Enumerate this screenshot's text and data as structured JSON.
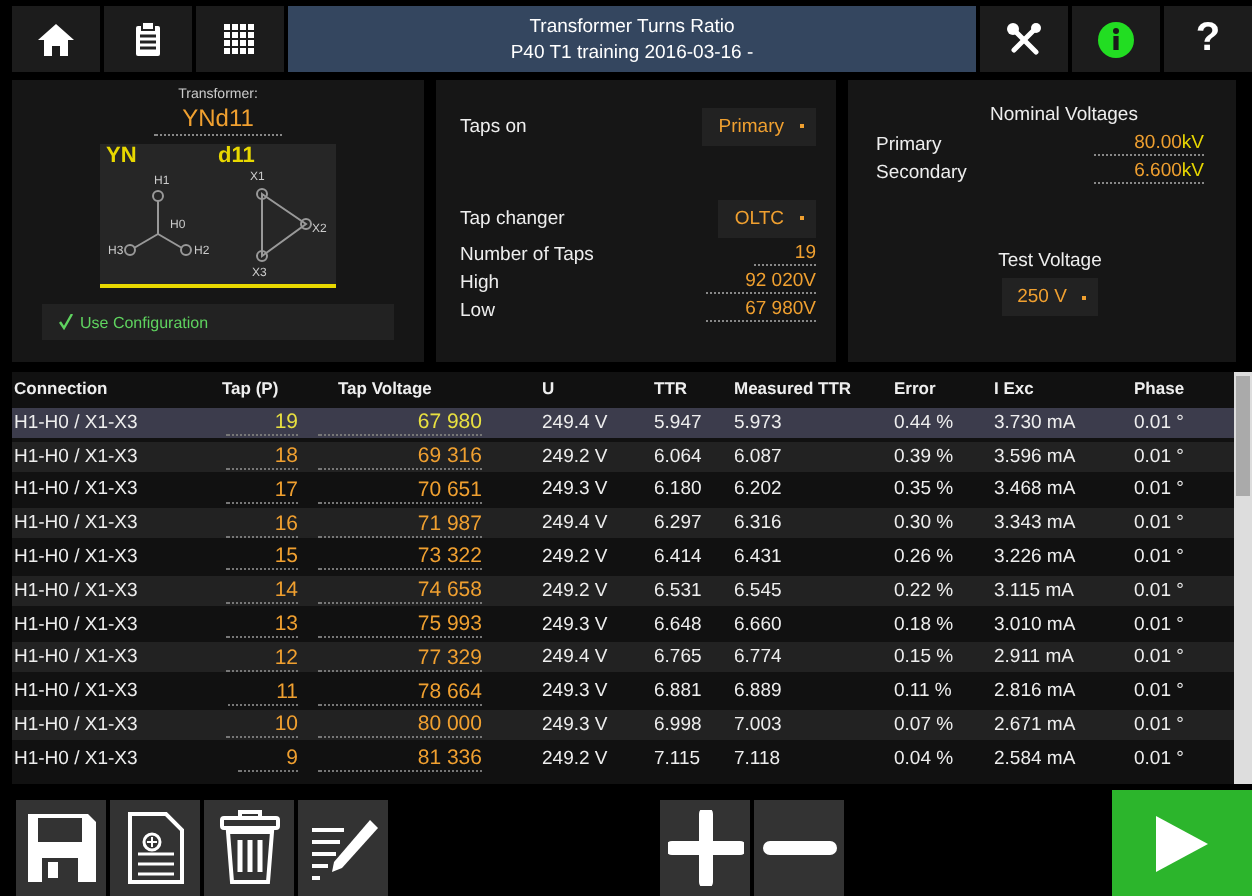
{
  "header": {
    "title": "Transformer Turns Ratio",
    "subtitle": "P40 T1 training 2016-03-16 -",
    "help": "?"
  },
  "transformer": {
    "label": "Transformer:",
    "vector_group": "YNd11",
    "primary_winding": "YN",
    "secondary_winding": "d11",
    "terminals": [
      "H1",
      "H0",
      "H3",
      "H2",
      "X1",
      "X2",
      "X3"
    ],
    "use_configuration": {
      "label": "Use Configuration",
      "checked": true
    }
  },
  "taps": {
    "taps_on": {
      "label": "Taps on",
      "value": "Primary"
    },
    "tap_changer": {
      "label": "Tap changer",
      "value": "OLTC"
    },
    "fields": [
      {
        "label": "Number of Taps",
        "value": "19"
      },
      {
        "label": "High",
        "value": "92 020",
        "unit": "V"
      },
      {
        "label": "Low",
        "value": "67 980",
        "unit": "V"
      }
    ]
  },
  "nominal": {
    "title": "Nominal Voltages",
    "fields": [
      {
        "label": "Primary",
        "value": "80.00",
        "unit": "kV"
      },
      {
        "label": "Secondary",
        "value": "6.600",
        "unit": "kV"
      }
    ],
    "test_voltage": {
      "label": "Test Voltage",
      "value": "250 V"
    }
  },
  "table": {
    "columns": [
      "Connection",
      "Tap (P)",
      "Tap Voltage",
      "U",
      "TTR",
      "Measured TTR",
      "Error",
      "I Exc",
      "Phase"
    ],
    "rows": [
      {
        "cells": [
          "H1-H0 / X1-X3",
          "19",
          "67 980",
          "249.4 V",
          "5.947",
          "5.973",
          "0.44 %",
          "3.730 mA",
          "0.01 °"
        ],
        "selected": true
      },
      {
        "cells": [
          "H1-H0 / X1-X3",
          "18",
          "69 316",
          "249.2 V",
          "6.064",
          "6.087",
          "0.39 %",
          "3.596 mA",
          "0.01 °"
        ],
        "selected": false
      },
      {
        "cells": [
          "H1-H0 / X1-X3",
          "17",
          "70 651",
          "249.3 V",
          "6.180",
          "6.202",
          "0.35 %",
          "3.468 mA",
          "0.01 °"
        ],
        "selected": false
      },
      {
        "cells": [
          "H1-H0 / X1-X3",
          "16",
          "71 987",
          "249.4 V",
          "6.297",
          "6.316",
          "0.30 %",
          "3.343 mA",
          "0.01 °"
        ],
        "selected": false
      },
      {
        "cells": [
          "H1-H0 / X1-X3",
          "15",
          "73 322",
          "249.2 V",
          "6.414",
          "6.431",
          "0.26 %",
          "3.226 mA",
          "0.01 °"
        ],
        "selected": false
      },
      {
        "cells": [
          "H1-H0 / X1-X3",
          "14",
          "74 658",
          "249.2 V",
          "6.531",
          "6.545",
          "0.22 %",
          "3.115 mA",
          "0.01 °"
        ],
        "selected": false
      },
      {
        "cells": [
          "H1-H0 / X1-X3",
          "13",
          "75 993",
          "249.3 V",
          "6.648",
          "6.660",
          "0.18 %",
          "3.010 mA",
          "0.01 °"
        ],
        "selected": false
      },
      {
        "cells": [
          "H1-H0 / X1-X3",
          "12",
          "77 329",
          "249.4 V",
          "6.765",
          "6.774",
          "0.15 %",
          "2.911 mA",
          "0.01 °"
        ],
        "selected": false
      },
      {
        "cells": [
          "H1-H0 / X1-X3",
          "11",
          "78 664",
          "249.3 V",
          "6.881",
          "6.889",
          "0.11 %",
          "2.816 mA",
          "0.01 °"
        ],
        "selected": false
      },
      {
        "cells": [
          "H1-H0 / X1-X3",
          "10",
          "80 000",
          "249.3 V",
          "6.998",
          "7.003",
          "0.07 %",
          "2.671 mA",
          "0.01 °"
        ],
        "selected": false
      },
      {
        "cells": [
          "H1-H0 / X1-X3",
          "9",
          "81 336",
          "249.2 V",
          "7.115",
          "7.118",
          "0.04 %",
          "2.584 mA",
          "0.01 °"
        ],
        "selected": false
      }
    ]
  }
}
